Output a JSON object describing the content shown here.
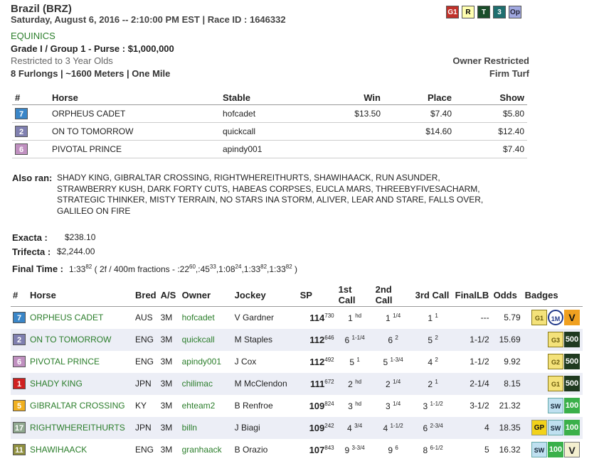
{
  "race": {
    "title": "Brazil (BRZ)",
    "date_line": "Saturday, August 6, 2016 -- 2:10:00 PM EST | Race ID : 1646332",
    "track": "EQUINICS",
    "grade_line": "Grade I / Group 1 - Purse : $1,000,000",
    "restriction": "Restricted to 3 Year Olds",
    "distance": "8 Furlongs | ~1600 Meters | One Mile",
    "owner_restriction": "Owner Restricted",
    "surface": "Firm Turf"
  },
  "top_badges": [
    {
      "label": "G1",
      "bg": "#c0312a",
      "fg": "#fff"
    },
    {
      "label": "R",
      "bg": "#ffffb0",
      "fg": "#000"
    },
    {
      "label": "T",
      "bg": "#1a4d2a",
      "fg": "#fff"
    },
    {
      "label": "3",
      "bg": "#1f6f6f",
      "fg": "#fff"
    },
    {
      "label": "Op",
      "bg": "#a0a8e0",
      "fg": "#223"
    }
  ],
  "results": {
    "headers": {
      "num": "#",
      "horse": "Horse",
      "stable": "Stable",
      "win": "Win",
      "place": "Place",
      "show": "Show"
    },
    "rows": [
      {
        "pp": "7",
        "pp_color": "#3a86c8",
        "horse": "ORPHEUS CADET",
        "stable": "hofcadet",
        "win": "$13.50",
        "place": "$7.40",
        "show": "$5.80"
      },
      {
        "pp": "2",
        "pp_color": "#8080b0",
        "horse": "ON TO TOMORROW",
        "stable": "quickcall",
        "win": "",
        "place": "$14.60",
        "show": "$12.40"
      },
      {
        "pp": "6",
        "pp_color": "#c090c0",
        "horse": "PIVOTAL PRINCE",
        "stable": "apindy001",
        "win": "",
        "place": "",
        "show": "$7.40"
      }
    ]
  },
  "also_ran": {
    "label": "Also ran:",
    "text": "SHADY KING, GIBRALTAR CROSSING, RIGHTWHEREITHURTS, SHAWIHAACK, RUN ASUNDER, STRAWBERRY KUSH, DARK FORTY CUTS, HABEAS CORPSES, EUCLA MARS, THREEBYFIVESACHARM, STRATEGIC THINKER, MISTY TERRAIN, NO STARS INA STORM, ALIVER, LEAR AND STARE, FALLS OVER, GALILEO ON FIRE"
  },
  "payouts": {
    "exacta_label": "Exacta :",
    "exacta": "$238.10",
    "trifecta_label": "Trifecta :",
    "trifecta": "$2,244.00",
    "final_label": "Final Time :",
    "final_time": "1:33",
    "final_time_sup": "82",
    "fractions_prefix": "( 2f / 400m fractions - :22",
    "fractions": [
      {
        "v": "60",
        "sep": ",:45"
      },
      {
        "v": "33",
        "sep": ",1:08"
      },
      {
        "v": "24",
        "sep": ",1:33"
      },
      {
        "v": "82",
        "sep": ",1:33"
      },
      {
        "v": "82",
        "sep": " )"
      }
    ]
  },
  "field": {
    "headers": {
      "num": "#",
      "horse": "Horse",
      "bred": "Bred",
      "as": "A/S",
      "owner": "Owner",
      "jockey": "Jockey",
      "sp": "SP",
      "c1": "1st Call",
      "c2": "2nd Call",
      "c3": "3rd Call",
      "final": "FinalLB",
      "odds": "Odds",
      "badges": "Badges"
    },
    "rows": [
      {
        "pp": "7",
        "pp_color": "#3a86c8",
        "horse": "ORPHEUS CADET",
        "bred": "AUS",
        "as": "3M",
        "owner": "hofcadet",
        "jockey": "V Gardner",
        "sp": "114",
        "sp_sup": "730",
        "c1": "1",
        "c1s": "hd",
        "c2": "1",
        "c2s": "1/4",
        "c3": "1",
        "c3s": "1",
        "final": "---",
        "odds": "5.79",
        "badges": [
          "star-g1",
          "1m",
          "v"
        ]
      },
      {
        "pp": "2",
        "pp_color": "#8080b0",
        "horse": "ON TO TOMORROW",
        "bred": "ENG",
        "as": "3M",
        "owner": "quickcall",
        "jockey": "M Staples",
        "sp": "112",
        "sp_sup": "646",
        "c1": "6",
        "c1s": "1-1/4",
        "c2": "6",
        "c2s": "2",
        "c3": "5",
        "c3s": "2",
        "final": "1-1/2",
        "odds": "15.69",
        "badges": [
          "star-g3",
          "500"
        ]
      },
      {
        "pp": "6",
        "pp_color": "#c090c0",
        "horse": "PIVOTAL PRINCE",
        "bred": "ENG",
        "as": "3M",
        "owner": "apindy001",
        "jockey": "J Cox",
        "sp": "112",
        "sp_sup": "492",
        "c1": "5",
        "c1s": "1",
        "c2": "5",
        "c2s": "1-3/4",
        "c3": "4",
        "c3s": "2",
        "final": "1-1/2",
        "odds": "9.92",
        "badges": [
          "star-g2",
          "500"
        ]
      },
      {
        "pp": "1",
        "pp_color": "#d02020",
        "horse": "SHADY KING",
        "bred": "JPN",
        "as": "3M",
        "owner": "chilimac",
        "jockey": "M McClendon",
        "sp": "111",
        "sp_sup": "672",
        "c1": "2",
        "c1s": "hd",
        "c2": "2",
        "c2s": "1/4",
        "c3": "2",
        "c3s": "1",
        "final": "2-1/4",
        "odds": "8.15",
        "badges": [
          "star-g1",
          "500"
        ]
      },
      {
        "pp": "5",
        "pp_color": "#f0b020",
        "horse": "GIBRALTAR CROSSING",
        "bred": "KY",
        "as": "3M",
        "owner": "ehteam2",
        "jockey": "B Renfroe",
        "sp": "109",
        "sp_sup": "824",
        "c1": "3",
        "c1s": "hd",
        "c2": "3",
        "c2s": "1/4",
        "c3": "3",
        "c3s": "1-1/2",
        "final": "3-1/2",
        "odds": "21.32",
        "badges": [
          "sw",
          "100"
        ]
      },
      {
        "pp": "17",
        "pp_color": "#90a890",
        "horse": "RIGHTWHEREITHURTS",
        "bred": "JPN",
        "as": "3M",
        "owner": "billn",
        "jockey": "J Biagi",
        "sp": "109",
        "sp_sup": "242",
        "c1": "4",
        "c1s": "3/4",
        "c2": "4",
        "c2s": "1-1/2",
        "c3": "6",
        "c3s": "2-3/4",
        "final": "4",
        "odds": "18.35",
        "badges": [
          "gp",
          "sw",
          "100"
        ]
      },
      {
        "pp": "11",
        "pp_color": "#909040",
        "horse": "SHAWIHAACK",
        "bred": "ENG",
        "as": "3M",
        "owner": "granhaack",
        "jockey": "B Orazio",
        "sp": "107",
        "sp_sup": "843",
        "c1": "9",
        "c1s": "3-3/4",
        "c2": "9",
        "c2s": "6",
        "c3": "8",
        "c3s": "6-1/2",
        "final": "5",
        "odds": "16.32",
        "badges": [
          "sw",
          "100",
          "vw"
        ]
      }
    ]
  }
}
